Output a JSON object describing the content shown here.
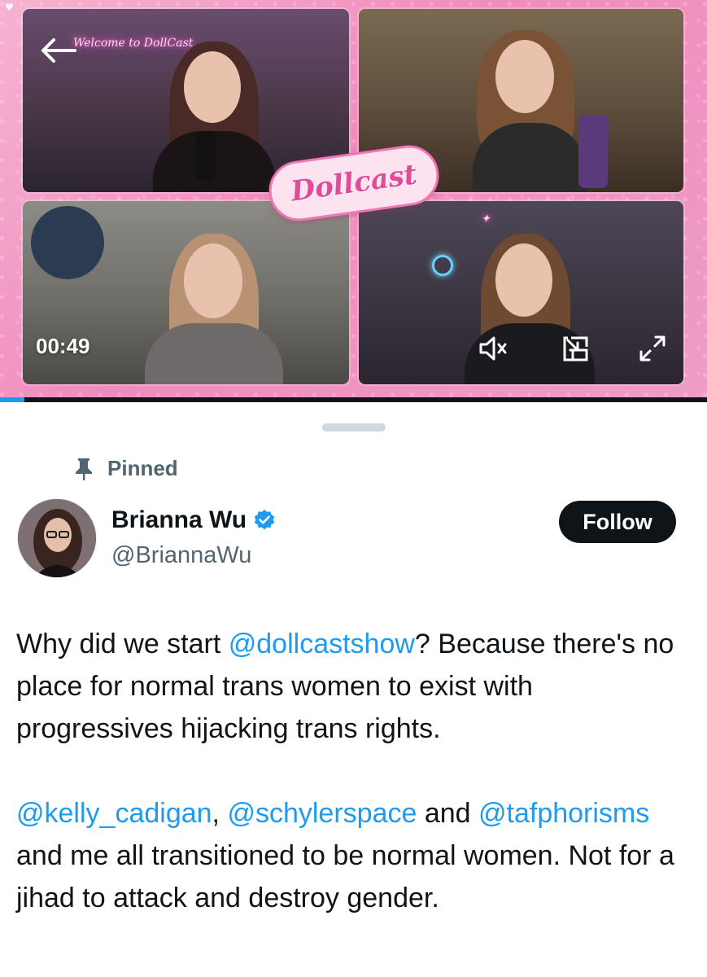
{
  "video": {
    "logo_text": "Dollcast",
    "neon_sign_text": "Welcome to DollCast",
    "timestamp": "00:49",
    "progress_fraction": 0.035,
    "controls": {
      "mute_icon": "speaker-muted-icon",
      "pip_icon": "picture-in-picture-icon",
      "fullscreen_icon": "expand-icon",
      "back_icon": "arrow-left-icon"
    }
  },
  "tweet": {
    "pinned_label": "Pinned",
    "author": {
      "name": "Brianna Wu",
      "handle": "@BriannaWu",
      "verified": true
    },
    "follow_label": "Follow",
    "paragraph1": {
      "part1": "Why did we start ",
      "mention1": "@dollcastshow",
      "part2": "? Because there's no place for normal trans women to exist with progressives hijacking trans rights."
    },
    "paragraph2": {
      "mention1": "@kelly_cadigan",
      "sep1": ", ",
      "mention2": "@schylerspace",
      "part1": " and ",
      "mention3": "@tafphorisms",
      "part2": " and me all transitioned to be normal women. Not for a jihad to attack and destroy gender."
    }
  },
  "colors": {
    "accent": "#1d9bf0",
    "text_primary": "#0f1419",
    "text_secondary": "#536471",
    "follow_bg": "#0f1419",
    "video_frame_pink": "#f08cbd"
  }
}
